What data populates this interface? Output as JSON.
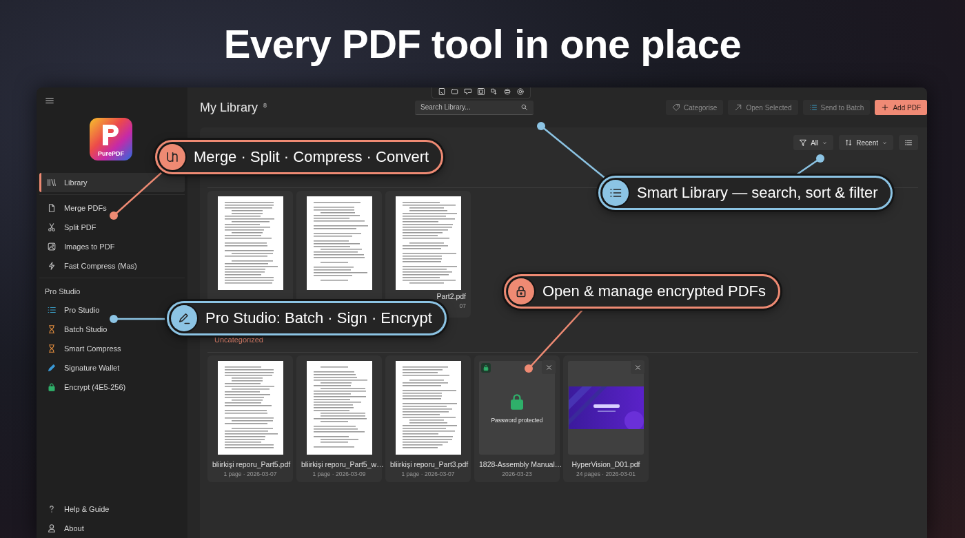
{
  "headline": "Every PDF tool in one place",
  "sidebar": {
    "logo_text": "PurePDF",
    "top_items": [
      {
        "label": "Library",
        "selected": true
      }
    ],
    "tool_items": [
      {
        "label": "Merge PDFs",
        "selected": false
      },
      {
        "label": "Split PDF",
        "selected": false
      },
      {
        "label": "Images to PDF",
        "selected": false
      },
      {
        "label": "Fast Compress (Mas)",
        "selected": false
      }
    ],
    "section_title": "Pro Studio",
    "pro_items": [
      {
        "label": "Pro Studio",
        "selected": false,
        "color": "#3a9cc4"
      },
      {
        "label": "Batch Studio",
        "selected": false,
        "color": "#d8873c"
      },
      {
        "label": "Smart Compress",
        "selected": false,
        "color": "#d8873c"
      },
      {
        "label": "Signature Wallet",
        "selected": false,
        "color": "#3b9ad8"
      },
      {
        "label": "Encrypt (4E5-256)",
        "selected": false,
        "color": "#2fb06a"
      }
    ],
    "footer_items": [
      {
        "label": "Help & Guide",
        "selected": false
      },
      {
        "label": "About",
        "selected": false
      }
    ]
  },
  "library": {
    "title": "My Library",
    "count": "8",
    "search": {
      "placeholder": "Search Library..."
    },
    "actions": [
      {
        "label": "Categorise",
        "kind": "secondary"
      },
      {
        "label": "Open Selected",
        "kind": "secondary"
      },
      {
        "label": "Send to Batch",
        "kind": "secondary"
      },
      {
        "label": "Add PDF",
        "kind": "primary"
      }
    ],
    "filter": "All",
    "sort": "Recent",
    "groups": [
      {
        "files": [
          {
            "kind": "document",
            "closable": false
          },
          {
            "kind": "document",
            "closable": false
          },
          {
            "kind": "document",
            "closable": false,
            "name": "Part2.pdf",
            "meta": "07"
          }
        ]
      },
      {
        "heading": "Uncategorized",
        "files": [
          {
            "kind": "document",
            "closable": false,
            "name": "bliirkişi reporu_Part5.pdf",
            "meta": "1 page · 2026-03-07"
          },
          {
            "kind": "document",
            "closable": false,
            "name": "bliirkişi reporu_Part5_w…",
            "meta": "1 page · 2026-03-09"
          },
          {
            "kind": "document",
            "closable": false,
            "name": "bliirkişi reporu_Part3.pdf",
            "meta": "1 page · 2026-03-07"
          },
          {
            "kind": "locked",
            "closable": true,
            "name": "1828-Assembly Manual…",
            "meta": "2026-03-23",
            "status": "Password protected"
          },
          {
            "kind": "picture",
            "closable": true,
            "name": "HyperVision_D01.pdf",
            "meta": "24 pages · 2026-03-01"
          }
        ]
      }
    ]
  },
  "callouts": [
    {
      "text": "Merge · Split · Compress · Convert",
      "color": "#ee8a73"
    },
    {
      "text": "Smart Library — search, sort & filter",
      "color": "#8cc4e4"
    },
    {
      "text": "Pro Studio: Batch · Sign · Encrypt",
      "color": "#8cc4e4"
    },
    {
      "text": "Open & manage encrypted PDFs",
      "color": "#ee8a73"
    }
  ]
}
